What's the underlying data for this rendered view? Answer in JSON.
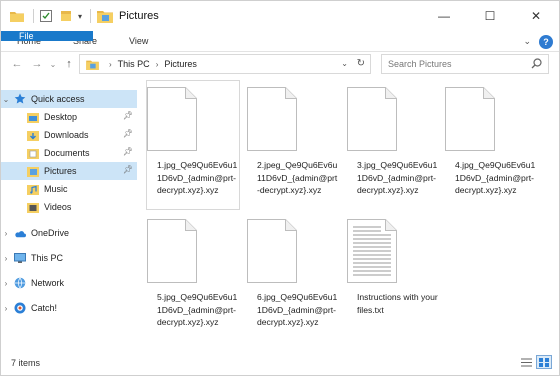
{
  "window": {
    "title": "Pictures"
  },
  "ribbon": {
    "tabs": [
      "File",
      "Home",
      "Share",
      "View"
    ]
  },
  "address": {
    "crumbs": [
      "This PC",
      "Pictures"
    ],
    "search_placeholder": "Search Pictures"
  },
  "sidebar": {
    "items": [
      {
        "label": "Quick access",
        "icon": "star-icon"
      },
      {
        "label": "Desktop",
        "icon": "desktop-folder-icon"
      },
      {
        "label": "Downloads",
        "icon": "downloads-folder-icon"
      },
      {
        "label": "Documents",
        "icon": "documents-folder-icon"
      },
      {
        "label": "Pictures",
        "icon": "pictures-folder-icon"
      },
      {
        "label": "Music",
        "icon": "music-folder-icon"
      },
      {
        "label": "Videos",
        "icon": "videos-folder-icon"
      },
      {
        "label": "OneDrive",
        "icon": "cloud-icon"
      },
      {
        "label": "This PC",
        "icon": "computer-icon"
      },
      {
        "label": "Network",
        "icon": "network-icon"
      },
      {
        "label": "Catch!",
        "icon": "catch-icon"
      }
    ]
  },
  "files": [
    {
      "name": "1.jpg_Qe9Qu6Ev6u11D6vD_{admin@prt-decrypt.xyz}.xyz"
    },
    {
      "name": "2.jpeg_Qe9Qu6Ev6u11D6vD_{admin@prt-decrypt.xyz}.xyz"
    },
    {
      "name": "3.jpg_Qe9Qu6Ev6u11D6vD_{admin@prt-decrypt.xyz}.xyz"
    },
    {
      "name": "4.jpg_Qe9Qu6Ev6u11D6vD_{admin@prt-decrypt.xyz}.xyz"
    },
    {
      "name": "5.jpg_Qe9Qu6Ev6u11D6vD_{admin@prt-decrypt.xyz}.xyz"
    },
    {
      "name": "6.jpg_Qe9Qu6Ev6u11D6vD_{admin@prt-decrypt.xyz}.xyz"
    },
    {
      "name": "Instructions with your files.txt"
    }
  ],
  "status": {
    "item_count": "7 items"
  },
  "colors": {
    "accent": "#1979ca",
    "selection": "#cce4f7"
  }
}
